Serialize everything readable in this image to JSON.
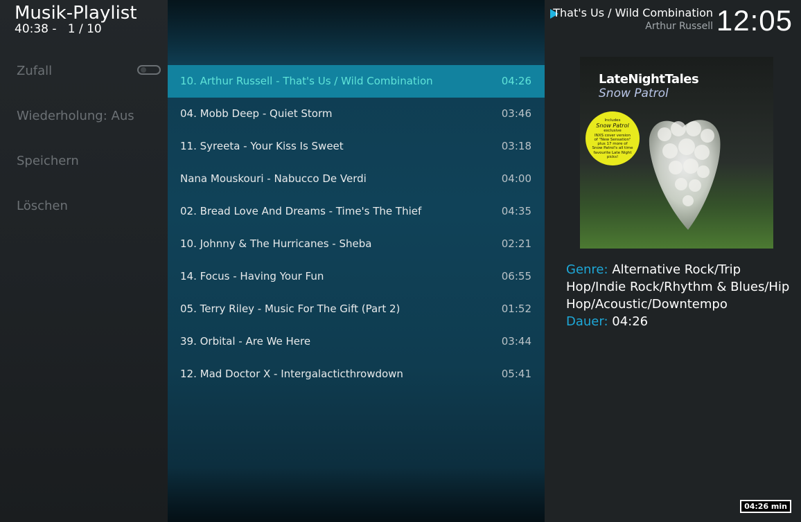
{
  "header": {
    "title": "Musik-Playlist",
    "total_time": "40:38",
    "separator": "-",
    "position": "1 / 10"
  },
  "sidebar": {
    "items": [
      {
        "label": "Zufall",
        "toggle_on": false
      },
      {
        "label": "Wiederholung: Aus"
      },
      {
        "label": "Speichern"
      },
      {
        "label": "Löschen"
      }
    ]
  },
  "playlist": {
    "selected_index": 0,
    "items": [
      {
        "title": "10. Arthur Russell - That's Us / Wild Combination",
        "duration": "04:26"
      },
      {
        "title": "04. Mobb Deep - Quiet Storm",
        "duration": "03:46"
      },
      {
        "title": "11. Syreeta - Your Kiss Is Sweet",
        "duration": "03:18"
      },
      {
        "title": "Nana Mouskouri - Nabucco De Verdi",
        "duration": "04:00"
      },
      {
        "title": "02. Bread Love And Dreams - Time's The Thief",
        "duration": "04:35"
      },
      {
        "title": "10. Johnny & The Hurricanes - Sheba",
        "duration": "02:21"
      },
      {
        "title": "14. Focus - Having Your Fun",
        "duration": "06:55"
      },
      {
        "title": "05. Terry Riley - Music For The Gift (Part 2)",
        "duration": "01:52"
      },
      {
        "title": "39. Orbital - Are We Here",
        "duration": "03:44"
      },
      {
        "title": "12. Mad Doctor X - Intergalacticthrowdown",
        "duration": "05:41"
      }
    ]
  },
  "now_playing": {
    "title": "That's Us / Wild Combination",
    "artist": "Arthur Russell",
    "icon": "play-icon",
    "accent_color": "#1fb4e0"
  },
  "clock": "12:05",
  "album_art": {
    "series": "LateNightTales",
    "artist": "Snow Patrol",
    "sticker_lines": [
      "Includes",
      "Snow Patrol",
      "exclusive",
      "INXS cover version",
      "of \"New Sensation\"",
      "plus 17 more of",
      "Snow Patrol's all time",
      "favourite Late Night",
      "picks!"
    ]
  },
  "info": {
    "genre_label": "Genre:",
    "genre_value": "Alternative Rock/Trip Hop/Indie Rock/Rhythm & Blues/Hip Hop/Acoustic/Downtempo",
    "duration_label": "Dauer:",
    "duration_value": "04:26"
  },
  "badge": "04:26 min",
  "colors": {
    "selected_row": "#12829f",
    "selected_text": "#5fe3d8",
    "label_blue": "#1ea8d8"
  }
}
